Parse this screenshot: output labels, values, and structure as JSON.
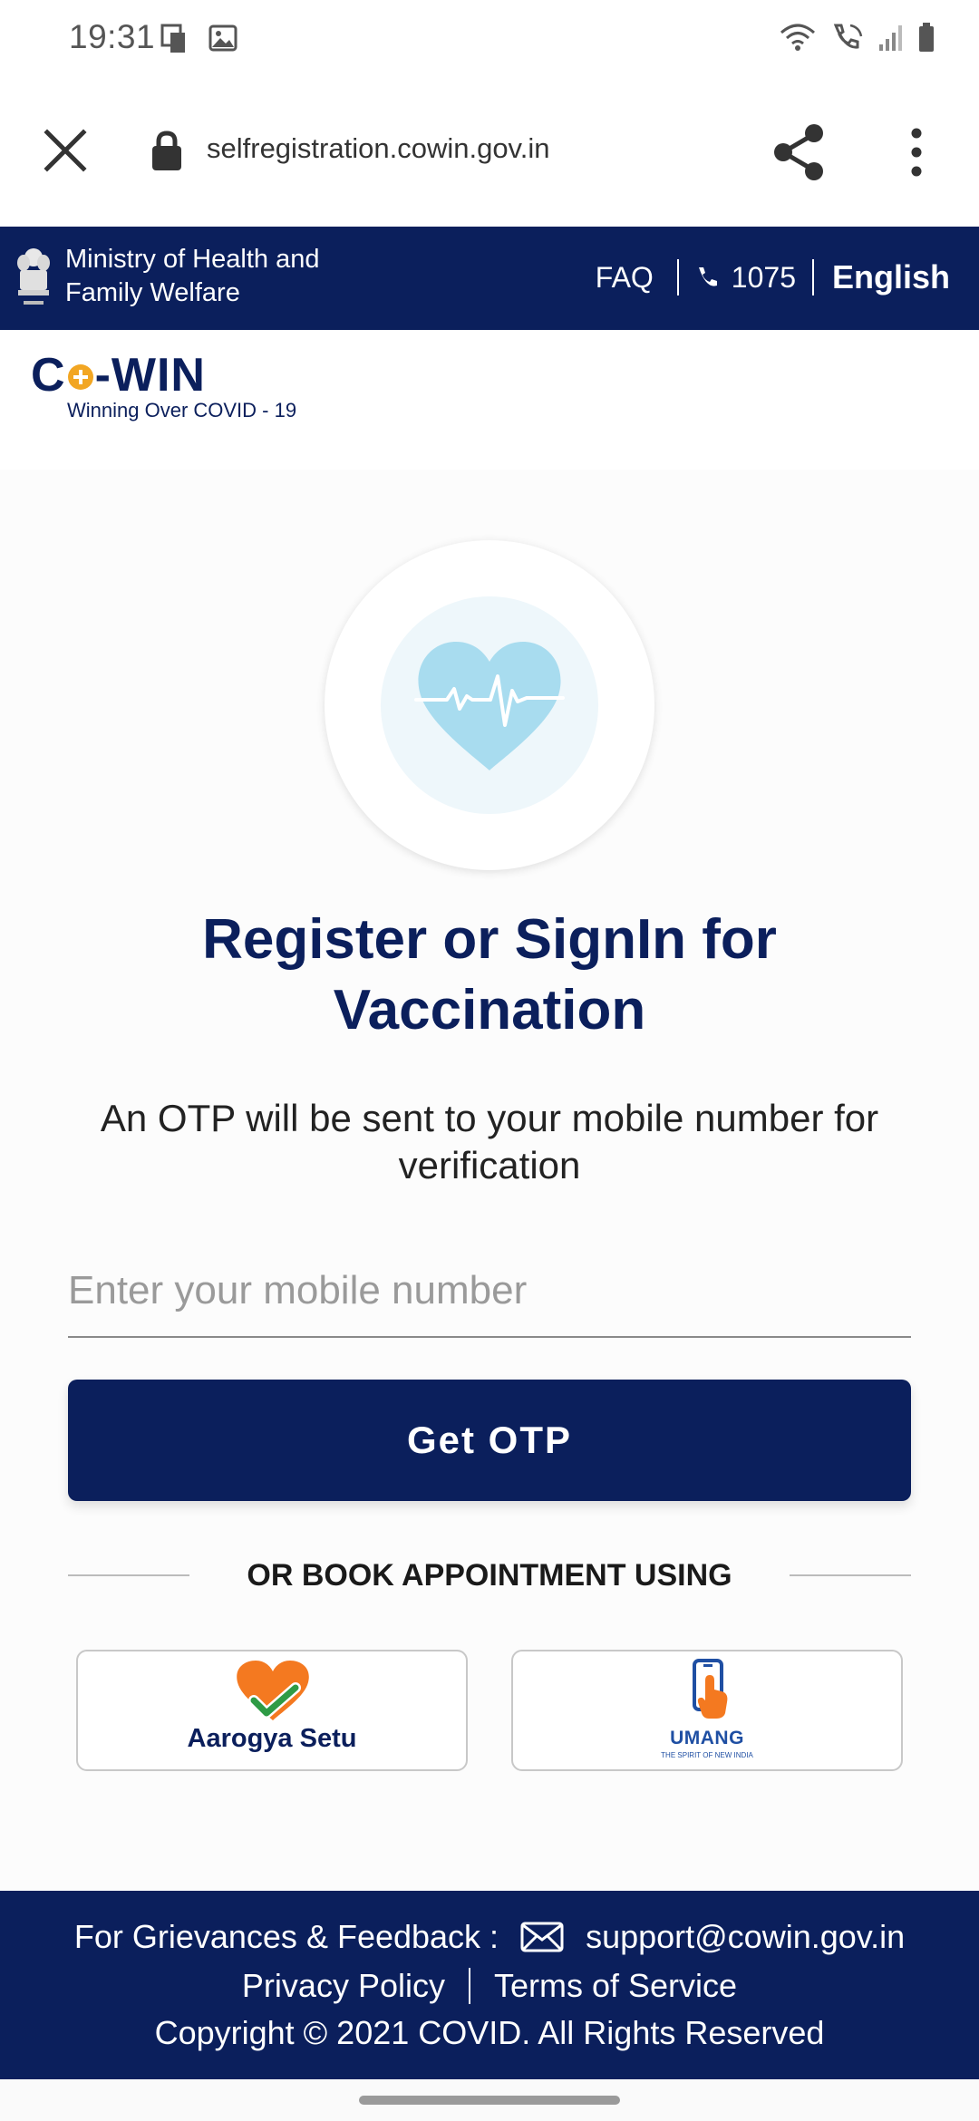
{
  "status_bar": {
    "time": "19:31"
  },
  "browser": {
    "url": "selfregistration.cowin.gov.in"
  },
  "header": {
    "ministry_line1": "Ministry of Health and",
    "ministry_line2": "Family Welfare",
    "faq_label": "FAQ",
    "helpline": "1075",
    "language": "English"
  },
  "logo": {
    "name_prefix": "C",
    "name_suffix": "-WIN",
    "tagline": "Winning Over COVID - 19"
  },
  "main": {
    "title": "Register or SignIn for Vaccination",
    "subtitle": "An OTP will be sent to your mobile number for verification",
    "mobile_placeholder": "Enter your mobile number",
    "get_otp_label": "Get OTP",
    "or_text": "OR BOOK APPOINTMENT USING",
    "aarogya_label": "Aarogya Setu",
    "umang_label": "UMANG",
    "umang_tagline": "THE SPIRIT OF NEW INDIA"
  },
  "footer": {
    "grievance_label": "For Grievances & Feedback :",
    "support_email": "support@cowin.gov.in",
    "privacy_label": "Privacy Policy",
    "terms_label": "Terms of Service",
    "copyright": "Copyright © 2021 COVID. All Rights Reserved"
  },
  "colors": {
    "navy": "#0b1f5c",
    "orange": "#f47920",
    "green": "#2e9b45",
    "heart_blue": "#a8dcef"
  }
}
